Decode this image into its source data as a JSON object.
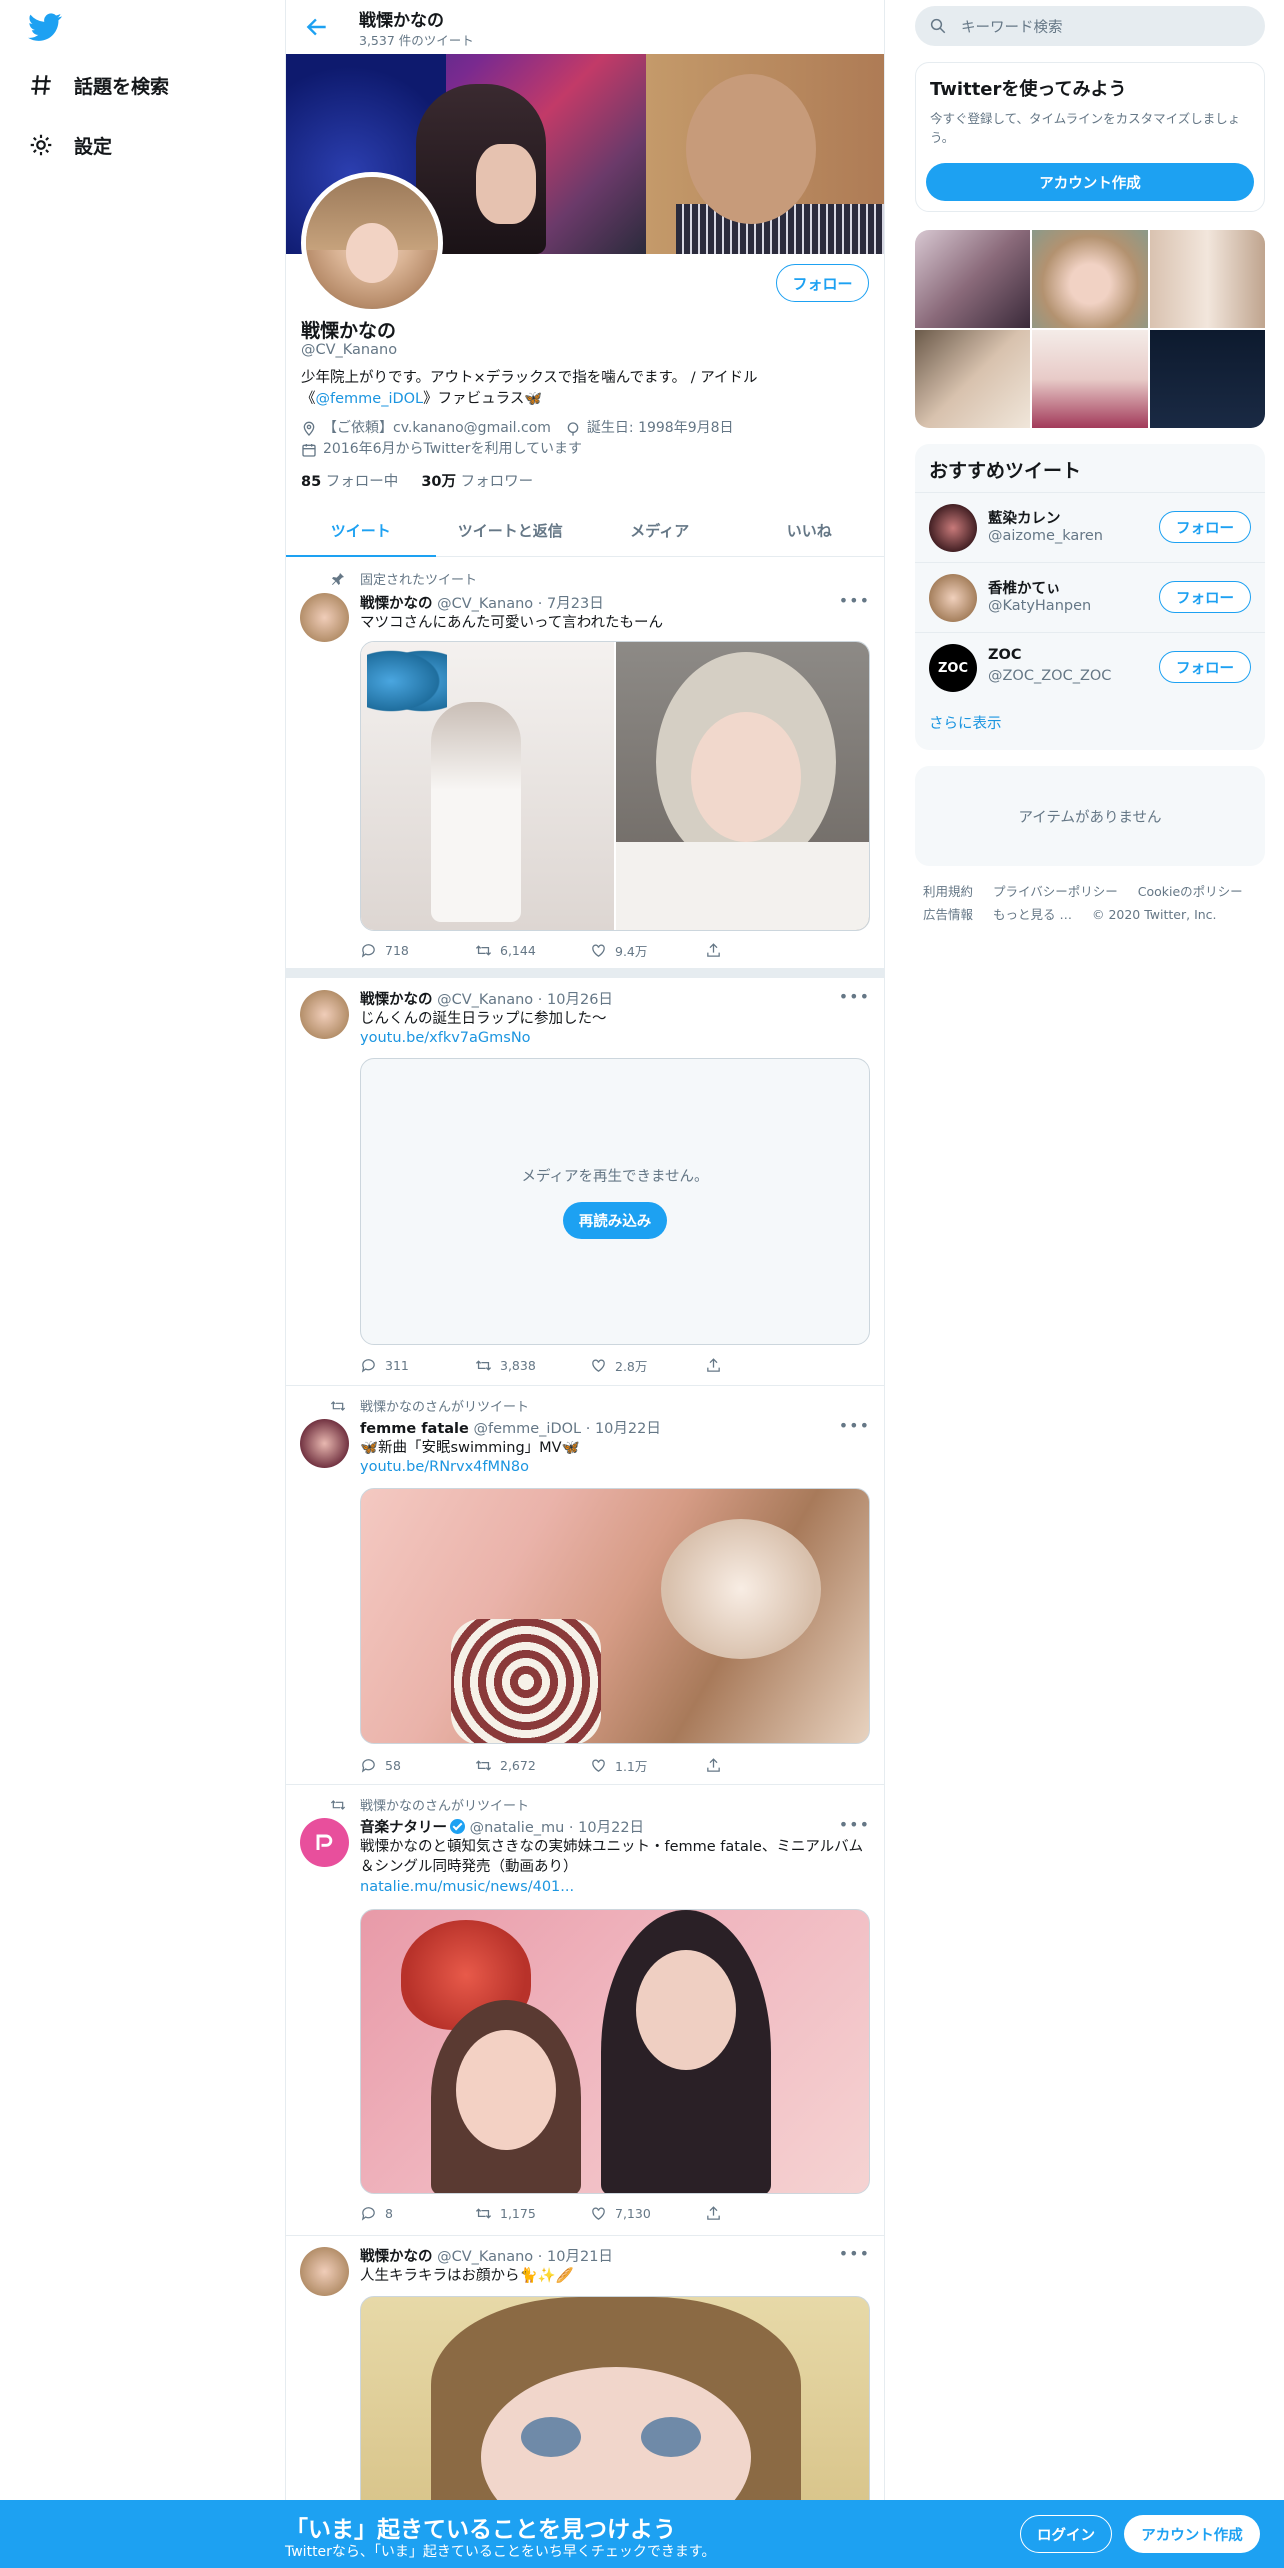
{
  "nav": {
    "logo_icon": "twitter-bird-icon",
    "items": [
      {
        "label": "話題を検索",
        "icon": "hashtag-icon"
      },
      {
        "label": "設定",
        "icon": "gear-icon"
      }
    ]
  },
  "header": {
    "name": "戦慄かなの",
    "tweet_count": "3,537 件のツイート"
  },
  "profile": {
    "name": "戦慄かなの",
    "handle": "@CV_Kanano",
    "follow_label": "フォロー",
    "bio_pre": "少年院上がりです。アウト×デラックスで指を噛んでます。 / アイドル《",
    "bio_link": "@femme_iDOL",
    "bio_post": "》ファビュラス🦋",
    "contact": "【ご依頼】cv.kanano@gmail.com",
    "birthday": "誕生日: 1998年9月8日",
    "joined": "2016年6月からTwitterを利用しています",
    "following_count": "85",
    "following_label": "フォロー中",
    "followers_count": "30万",
    "followers_label": "フォロワー"
  },
  "tabs": [
    "ツイート",
    "ツイートと返信",
    "メディア",
    "いいね"
  ],
  "tweets": [
    {
      "context": "固定されたツイート",
      "name": "戦慄かなの",
      "handle": "@CV_Kanano",
      "date": "7月23日",
      "text": "マツコさんにあんた可愛いって言われたもーん",
      "replies": "718",
      "retweets": "6,144",
      "likes": "9.4万"
    },
    {
      "name": "戦慄かなの",
      "handle": "@CV_Kanano",
      "date": "10月26日",
      "text": "じんくんの誕生日ラップに参加した〜",
      "link": "youtu.be/xfkv7aGmsNo",
      "media_error": "メディアを再生できません。",
      "reload_label": "再読み込み",
      "replies": "311",
      "retweets": "3,838",
      "likes": "2.8万"
    },
    {
      "context": "戦慄かなのさんがリツイート",
      "name": "femme fatale",
      "handle": "@femme_iDOL",
      "date": "10月22日",
      "text": "🦋新曲「安眠swimming」MV🦋",
      "link": "youtu.be/RNrvx4fMN8o",
      "replies": "58",
      "retweets": "2,672",
      "likes": "1.1万"
    },
    {
      "context": "戦慄かなのさんがリツイート",
      "name": "音楽ナタリー",
      "handle": "@natalie_mu",
      "date": "10月22日",
      "text": "戦慄かなのと頓知気さきなの実姉妹ユニット・femme fatale、ミニアルバム＆シングル同時発売（動画あり）",
      "link": "natalie.mu/music/news/401...",
      "replies": "8",
      "retweets": "1,175",
      "likes": "7,130"
    },
    {
      "name": "戦慄かなの",
      "handle": "@CV_Kanano",
      "date": "10月21日",
      "text": "人生キラキラはお顔から🐈✨🥖"
    }
  ],
  "right": {
    "search_placeholder": "キーワード検索",
    "cta_title": "Twitterを使ってみよう",
    "cta_text": "今すぐ登録して、タイムラインをカスタマイズしましょう。",
    "cta_button": "アカウント作成",
    "rec_title": "おすすめツイート",
    "rec_users": [
      {
        "name": "藍染カレン",
        "handle": "@aizome_karen",
        "button": "フォロー"
      },
      {
        "name": "香椎かてぃ",
        "handle": "@KatyHanpen",
        "button": "フォロー"
      },
      {
        "name": "ZOC",
        "handle": "@ZOC_ZOC_ZOC",
        "button": "フォロー"
      }
    ],
    "show_more": "さらに表示",
    "no_items": "アイテムがありません",
    "footer_links": [
      "利用規約",
      "プライバシーポリシー",
      "Cookieのポリシー",
      "広告情報",
      "もっと見る …"
    ],
    "copyright": "© 2020 Twitter, Inc."
  },
  "bottom_bar": {
    "title": "「いま」起きていることを見つけよう",
    "subtitle": "Twitterなら、「いま」起きていることをいち早くチェックできます。",
    "login": "ログイン",
    "signup": "アカウント作成"
  },
  "colors": {
    "accent": "#1da1f2",
    "link": "#1b95e0",
    "secondary_text": "#657786",
    "border": "#e6ecf0"
  }
}
